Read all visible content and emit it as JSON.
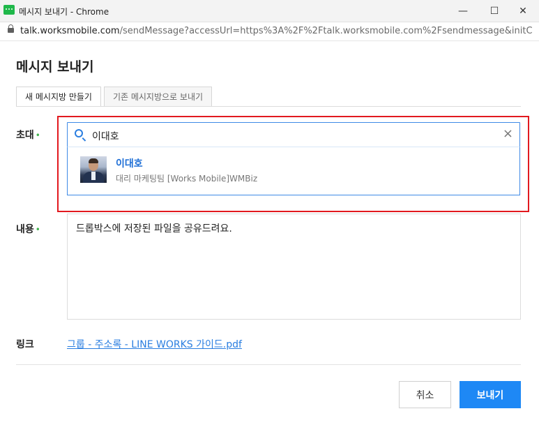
{
  "window": {
    "title": "메시지 보내기 - Chrome",
    "minimize": "—",
    "maximize": "☐",
    "close": "✕"
  },
  "urlbar": {
    "host": "talk.worksmobile.com",
    "path": "/sendMessage?accessUrl=https%3A%2F%2Ftalk.worksmobile.com%2Fsendmessage&initConten..."
  },
  "dialog": {
    "title": "메시지 보내기",
    "tabs": [
      {
        "label": "새 메시지방 만들기",
        "active": true
      },
      {
        "label": "기존 메시지방으로 보내기",
        "active": false
      }
    ],
    "invite": {
      "label": "초대",
      "required_mark": "•",
      "search_value": "이대호",
      "clear": "×",
      "results": [
        {
          "name": "이대호",
          "info": "대리  마케팅팀 [Works Mobile]WMBiz"
        }
      ]
    },
    "content": {
      "label": "내용",
      "required_mark": "•",
      "value": "드롭박스에 저장된 파일을 공유드려요."
    },
    "link": {
      "label": "링크",
      "value": "그룹 - 주소록 - LINE WORKS 가이드.pdf"
    },
    "buttons": {
      "cancel": "취소",
      "send": "보내기"
    }
  },
  "colors": {
    "accent": "#1e88f5",
    "highlight_border": "#e2191f",
    "required": "#3fb24c",
    "link": "#2a7ee0"
  }
}
